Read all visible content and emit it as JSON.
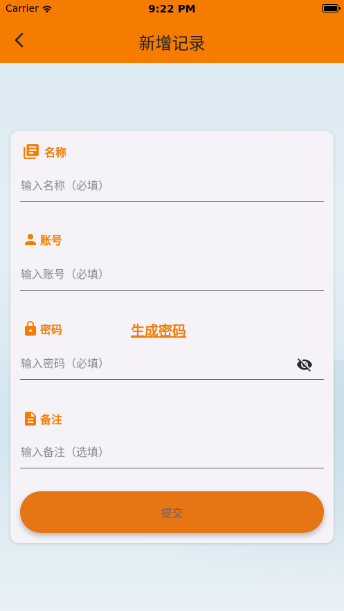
{
  "status_bar": {
    "carrier": "Carrier",
    "time": "9:22 PM"
  },
  "header": {
    "title": "新增记录",
    "back_icon": "chevron-left-icon"
  },
  "form": {
    "name": {
      "label": "名称",
      "icon": "library-books-icon",
      "placeholder": "输入名称（必填）"
    },
    "account": {
      "label": "账号",
      "icon": "person-icon",
      "placeholder": "输入账号（必填）"
    },
    "password": {
      "label": "密码",
      "icon": "lock-icon",
      "placeholder": "输入密码（必填）",
      "generate_label": "生成密码",
      "visibility_icon": "eye-off-icon"
    },
    "note": {
      "label": "备注",
      "icon": "document-icon",
      "placeholder": "输入备注（选填）"
    },
    "submit_label": "提交"
  },
  "colors": {
    "accent": "#f57c00",
    "button": "#e57613",
    "card": "#f5f2f8"
  }
}
